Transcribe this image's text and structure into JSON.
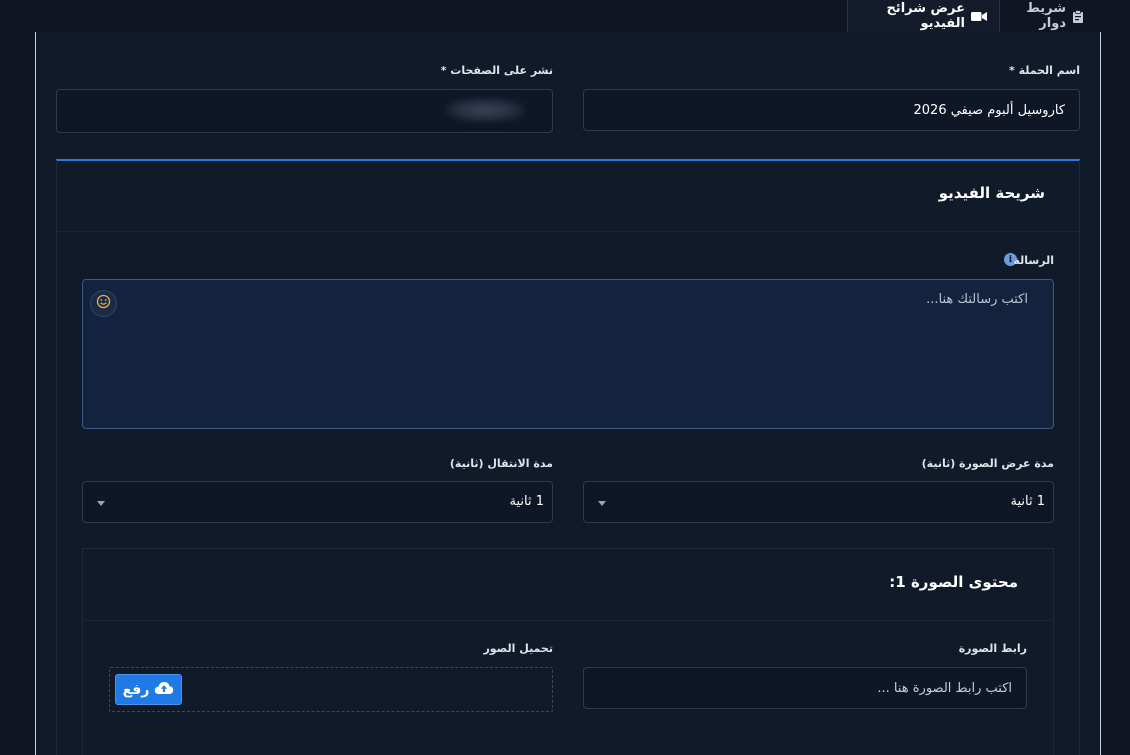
{
  "tabs": [
    {
      "label": "شريط دوار",
      "icon": "clipboard-icon"
    },
    {
      "label": "عرض شرائح الفيديو",
      "icon": "video-camera-icon",
      "active": true
    }
  ],
  "form": {
    "campaign_name_label": "اسم الحملة *",
    "campaign_name_value": "كاروسيل ألبوم صيفي 2026",
    "publish_pages_label": "نشر على الصفحات *",
    "publish_pages_value": ""
  },
  "video_slide": {
    "title": "شريحة الفيديو",
    "message_label": "الرسالة",
    "message_placeholder": "اكتب رسالتك هنا...",
    "image_duration_label": "مدة عرض الصورة (ثانية)",
    "image_duration_value": "1 ثانية",
    "transition_duration_label": "مدة الانتقال (ثانية)",
    "transition_duration_value": "1 ثانية"
  },
  "image_content": {
    "title": "محتوى الصورة 1:",
    "image_url_label": "رابط الصورة",
    "image_url_placeholder": "اكتب رابط الصورة هنا ...",
    "upload_label": "تحميل الصور",
    "upload_button": "رفع"
  },
  "colors": {
    "accent": "#2d7be0",
    "button": "#1f7ae6",
    "background": "#0f1522"
  }
}
